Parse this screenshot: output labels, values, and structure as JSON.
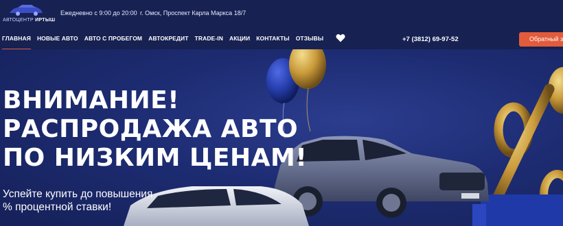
{
  "header": {
    "logo": {
      "line1": "АВТОЦЕНТР",
      "line2": "ИРТЫШ"
    },
    "hours": "Ежедневно с 9:00 до 20:00",
    "address": "г. Омск, Проспект Карла Маркса 18/7"
  },
  "nav": {
    "items": [
      {
        "label": "ГЛАВНАЯ",
        "active": true
      },
      {
        "label": "НОВЫЕ АВТО"
      },
      {
        "label": "АВТО С ПРОБЕГОМ"
      },
      {
        "label": "АВТОКРЕДИТ"
      },
      {
        "label": "TRADE-IN"
      },
      {
        "label": "АКЦИИ"
      },
      {
        "label": "КОНТАКТЫ"
      },
      {
        "label": "ОТЗЫВЫ"
      }
    ],
    "phone": "+7 (3812) 69-97-52",
    "callback_label": "Обратный звонок",
    "icons": {
      "favorites": "heart-icon"
    }
  },
  "hero": {
    "headline": [
      "ВНИМАНИЕ!",
      "РАСПРОДАЖА АВТО",
      "ПО НИЗКИМ ЦЕНАМ!"
    ],
    "subline": [
      "Успейте купить до повышения",
      "% процентной ставки!"
    ]
  },
  "colors": {
    "background": "#1b2a6b",
    "header": "#172152",
    "accent": "#e25b3b"
  }
}
